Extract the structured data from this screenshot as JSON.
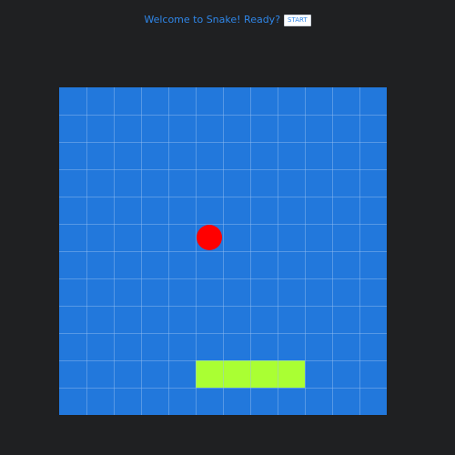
{
  "header": {
    "welcome_text": "Welcome to Snake! Ready?",
    "start_label": "START"
  },
  "board": {
    "columns": 12,
    "rows": 12,
    "background_color": "#2278dc",
    "grid_line_color": "#8fb9ee"
  },
  "snake": {
    "color": "#aaff33",
    "segments": [
      {
        "col": 5,
        "row": 10
      },
      {
        "col": 6,
        "row": 10
      },
      {
        "col": 7,
        "row": 10
      },
      {
        "col": 8,
        "row": 10
      }
    ]
  },
  "food": {
    "color": "#ff0000",
    "col": 5,
    "row": 5
  }
}
